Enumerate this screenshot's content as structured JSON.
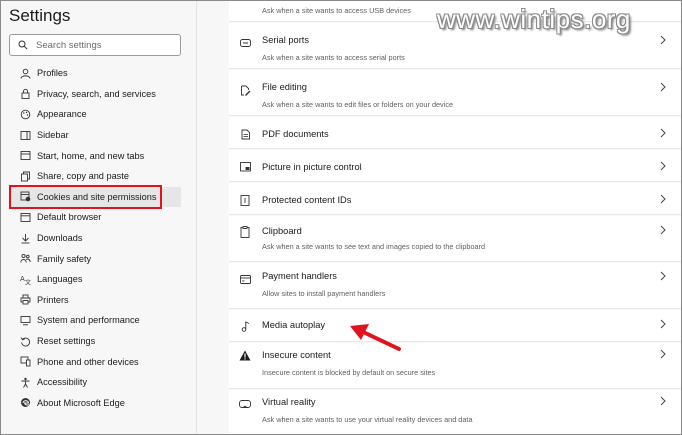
{
  "sidebar": {
    "title": "Settings",
    "search_placeholder": "Search settings",
    "items": [
      {
        "label": "Profiles",
        "icon": "profile-icon"
      },
      {
        "label": "Privacy, search, and services",
        "icon": "lock-icon"
      },
      {
        "label": "Appearance",
        "icon": "appearance-icon"
      },
      {
        "label": "Sidebar",
        "icon": "sidebar-icon"
      },
      {
        "label": "Start, home, and new tabs",
        "icon": "home-icon"
      },
      {
        "label": "Share, copy and paste",
        "icon": "share-icon"
      },
      {
        "label": "Cookies and site permissions",
        "icon": "cookies-icon",
        "selected": true
      },
      {
        "label": "Default browser",
        "icon": "browser-icon"
      },
      {
        "label": "Downloads",
        "icon": "download-icon"
      },
      {
        "label": "Family safety",
        "icon": "family-icon"
      },
      {
        "label": "Languages",
        "icon": "languages-icon"
      },
      {
        "label": "Printers",
        "icon": "printer-icon"
      },
      {
        "label": "System and performance",
        "icon": "system-icon"
      },
      {
        "label": "Reset settings",
        "icon": "reset-icon"
      },
      {
        "label": "Phone and other devices",
        "icon": "phone-icon"
      },
      {
        "label": "Accessibility",
        "icon": "accessibility-icon"
      },
      {
        "label": "About Microsoft Edge",
        "icon": "edge-icon"
      }
    ]
  },
  "main": {
    "top_desc": "Ask when a site wants to access USB devices",
    "permissions": [
      {
        "title": "Serial ports",
        "desc": "Ask when a site wants to access serial ports",
        "icon": "serial-port-icon"
      },
      {
        "title": "File editing",
        "desc": "Ask when a site wants to edit files or folders on your device",
        "icon": "file-edit-icon"
      },
      {
        "title": "PDF documents",
        "desc": "",
        "icon": "pdf-icon"
      },
      {
        "title": "Picture in picture control",
        "desc": "",
        "icon": "picture-in-picture-icon"
      },
      {
        "title": "Protected content IDs",
        "desc": "",
        "icon": "protected-content-icon"
      },
      {
        "title": "Clipboard",
        "desc": "Ask when a site wants to see text and images copied to the clipboard",
        "icon": "clipboard-icon"
      },
      {
        "title": "Payment handlers",
        "desc": "Allow sites to install payment handlers",
        "icon": "payment-icon"
      },
      {
        "title": "Media autoplay",
        "desc": "",
        "icon": "music-note-icon"
      },
      {
        "title": "Insecure content",
        "desc": "Insecure content is blocked by default on secure sites",
        "icon": "warning-icon"
      },
      {
        "title": "Virtual reality",
        "desc": "Ask when a site wants to use your virtual reality devices and data",
        "icon": "vr-headset-icon"
      }
    ]
  },
  "watermark": "www.wintips.org",
  "colors": {
    "highlight": "#e0141e",
    "arrow": "#e0141e"
  }
}
